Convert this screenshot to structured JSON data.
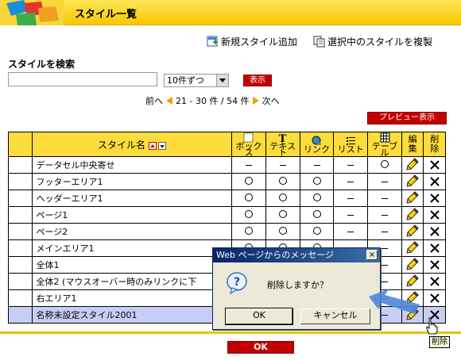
{
  "header": {
    "title": "スタイル一覧"
  },
  "actions": {
    "add_new": "新規スタイル追加",
    "copy_selected": "選択中のスタイルを複製"
  },
  "search": {
    "label": "スタイルを検索",
    "value": "",
    "per_page": "10件ずつ",
    "submit": "表示"
  },
  "pager": {
    "prev": "前へ",
    "range": "21 - 30 件 / 54 件",
    "next": "次へ"
  },
  "preview_button": "プレビュー表示",
  "table": {
    "header_name": "スタイル名",
    "columns": [
      "ボックス",
      "テキスト",
      "リンク",
      "リスト",
      "テーブル"
    ],
    "edit_header": "編集",
    "delete_header": "削除",
    "rows": [
      {
        "name": "データセル中央寄せ",
        "cells": [
          "dash",
          "dash",
          "dash",
          "dash",
          "circle"
        ]
      },
      {
        "name": "フッターエリア1",
        "cells": [
          "circle",
          "circle",
          "circle",
          "dash",
          "dash"
        ]
      },
      {
        "name": "ヘッダーエリア1",
        "cells": [
          "circle",
          "circle",
          "circle",
          "dash",
          "dash"
        ]
      },
      {
        "name": "ページ1",
        "cells": [
          "circle",
          "circle",
          "circle",
          "dash",
          "dash"
        ]
      },
      {
        "name": "ページ2",
        "cells": [
          "circle",
          "circle",
          "circle",
          "dash",
          "dash"
        ]
      },
      {
        "name": "メインエリア1",
        "cells": [
          "circle",
          "circle",
          "circle",
          "dash",
          "dash"
        ]
      },
      {
        "name": "全体1",
        "cells": [
          "circle",
          "circle",
          "circle",
          "dash",
          "dash"
        ]
      },
      {
        "name": "全体2 (マウスオーバー時のみリンクに下",
        "cells": [
          "circle",
          "circle",
          "circle",
          "dash",
          "dash"
        ]
      },
      {
        "name": "右エリア1",
        "cells": [
          "circle",
          "circle",
          "circle",
          "dash",
          "dash"
        ]
      },
      {
        "name": "名称未設定スタイル2001",
        "cells": [
          "circle",
          "circle",
          "circle",
          "dash",
          "dash"
        ]
      }
    ]
  },
  "ok_button": "OK",
  "dialog": {
    "title": "Web ページからのメッセージ",
    "message": "削除しますか？",
    "ok": "OK",
    "cancel": "キャンセル",
    "close": "×"
  },
  "tooltip": "削除",
  "colors": {
    "header_yellow": "#f7c800",
    "table_head": "#fddc3c",
    "button_red": "#c30000",
    "selected_row": "#c8cdf5",
    "dialog_title": "#0a246a"
  }
}
